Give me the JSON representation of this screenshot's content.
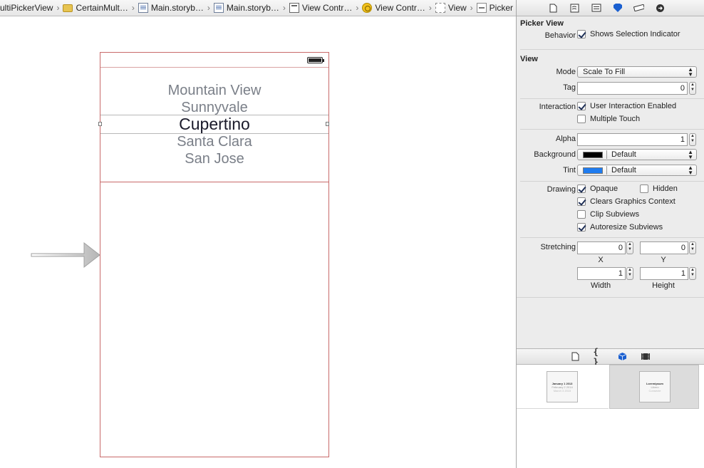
{
  "breadcrumb": [
    {
      "label": "ultiPickerView",
      "icon": "project-icon"
    },
    {
      "label": "CertainMult…",
      "icon": "folder-icon"
    },
    {
      "label": "Main.storyb…",
      "icon": "storyboard-file-icon"
    },
    {
      "label": "Main.storyb…",
      "icon": "storyboard-file-icon"
    },
    {
      "label": "View Contr…",
      "icon": "view-controller-scene-icon"
    },
    {
      "label": "View Contr…",
      "icon": "view-controller-object-icon"
    },
    {
      "label": "View",
      "icon": "view-icon"
    },
    {
      "label": "Picker",
      "icon": "picker-icon"
    }
  ],
  "picker": {
    "rows": [
      "Mountain View",
      "Sunnyvale",
      "Cupertino",
      "Santa Clara",
      "San Jose"
    ],
    "selected_index": 2
  },
  "inspector": {
    "tabs": [
      "file-inspector-icon",
      "quick-help-icon",
      "identity-inspector-icon",
      "attributes-inspector-icon",
      "size-inspector-icon",
      "connections-inspector-icon"
    ],
    "active_tab": "attributes-inspector-icon",
    "picker_section": {
      "title": "Picker View",
      "behavior_label": "Behavior",
      "shows_selection_indicator": {
        "label": "Shows Selection Indicator",
        "checked": true
      }
    },
    "view_section": {
      "title": "View",
      "mode_label": "Mode",
      "mode_value": "Scale To Fill",
      "tag_label": "Tag",
      "tag_value": "0",
      "interaction_label": "Interaction",
      "user_interaction": {
        "label": "User Interaction Enabled",
        "checked": true
      },
      "multiple_touch": {
        "label": "Multiple Touch",
        "checked": false
      },
      "alpha_label": "Alpha",
      "alpha_value": "1",
      "background_label": "Background",
      "background_value": "Default",
      "background_color": "#000000",
      "tint_label": "Tint",
      "tint_value": "Default",
      "tint_color": "#1f7cf0",
      "drawing_label": "Drawing",
      "opaque": {
        "label": "Opaque",
        "checked": true
      },
      "hidden": {
        "label": "Hidden",
        "checked": false
      },
      "clears_graphics": {
        "label": "Clears Graphics Context",
        "checked": true
      },
      "clip_subviews": {
        "label": "Clip Subviews",
        "checked": false
      },
      "autoresize_subviews": {
        "label": "Autoresize Subviews",
        "checked": true
      },
      "stretching_label": "Stretching",
      "stretch_x": "0",
      "stretch_y": "0",
      "stretch_width": "1",
      "stretch_height": "1",
      "x_label": "X",
      "y_label": "Y",
      "width_label": "Width",
      "height_label": "Height"
    }
  },
  "library": {
    "tabs": [
      "file-template-icon",
      "code-snippet-icon",
      "object-library-icon",
      "media-library-icon"
    ],
    "active_tab": "object-library-icon",
    "items": [
      {
        "name": "date-picker-thumbnail",
        "lines": [
          "January 1 2013",
          "February 2 2014",
          "March 3 2015"
        ]
      },
      {
        "name": "picker-view-thumbnail",
        "lines": [
          "Loremipsum",
          "Libero",
          "Consecte"
        ]
      }
    ]
  }
}
